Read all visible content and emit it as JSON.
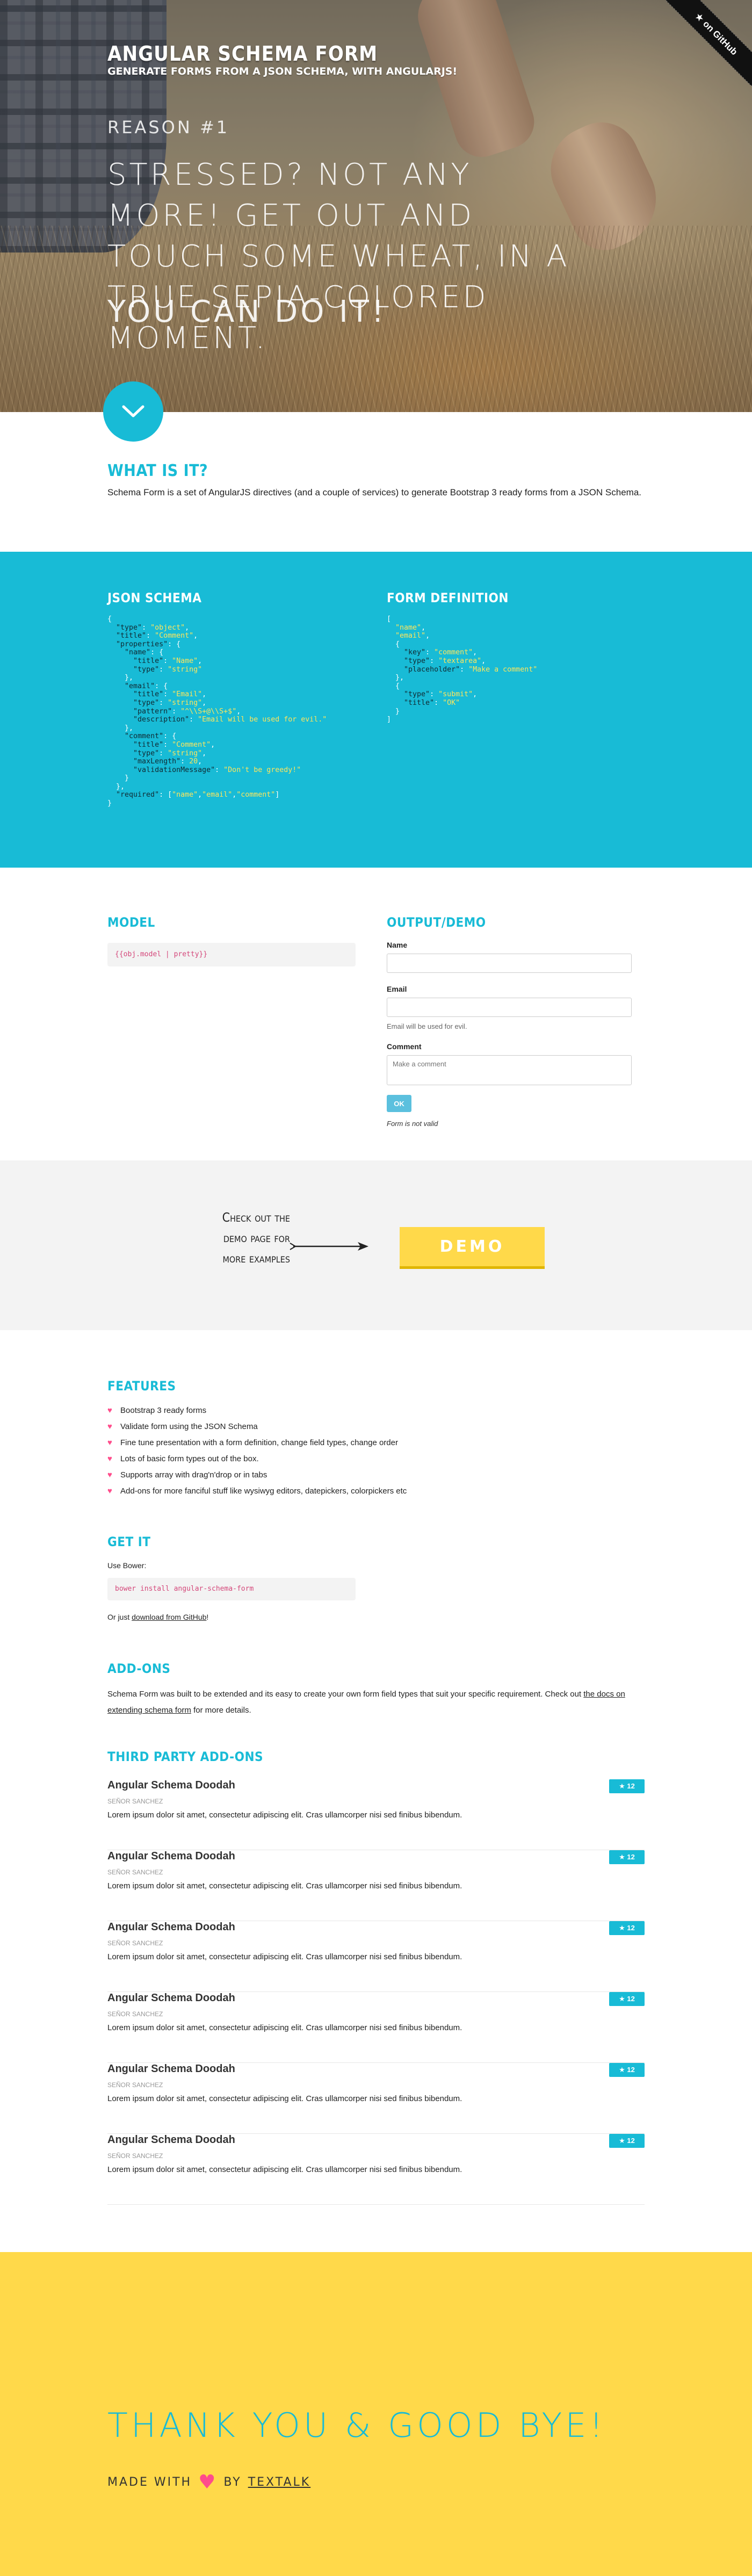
{
  "hero": {
    "title": "Angular Schema Form",
    "subtitle": "Generate forms from a JSON schema, with AngularJS!",
    "reason": "Reason #1",
    "quote": "Stressed? Not any more! Get out and touch some wheat, in a true sepia-colored moment.",
    "cta": "You can do it!",
    "github_ribbon": "on GitHub",
    "scroll_icon": "chevron-down-icon"
  },
  "what": {
    "heading": "What is it?",
    "text": "Schema Form is a set of AngularJS directives (and a couple of services) to generate Bootstrap 3 ready forms from a JSON Schema."
  },
  "schema": {
    "heading": "JSON Schema",
    "form_heading": "Form Definition"
  },
  "model": {
    "heading": "Model",
    "value": "{{obj.model | pretty}}"
  },
  "demo_form": {
    "heading": "Output/Demo",
    "name_label": "Name",
    "name_value": "",
    "email_label": "Email",
    "email_value": "",
    "email_help": "Email will be used for evil.",
    "comment_label": "Comment",
    "comment_placeholder": "Make a comment",
    "submit_label": "OK",
    "status": "Form is not valid"
  },
  "demo_cta": {
    "text": "Check out the demo page for more examples",
    "button": "Demo"
  },
  "features": {
    "heading": "Features",
    "items": [
      "Bootstrap 3 ready forms",
      "Validate form using the JSON Schema",
      "Fine tune presentation with a form definition, change field types, change order",
      "Lots of basic form types out of the box.",
      "Supports array with drag'n'drop or in tabs",
      "Add-ons for more fanciful stuff like wysiwyg editors, datepickers, colorpickers etc"
    ]
  },
  "get_it": {
    "heading": "Get it",
    "use_bower": "Use Bower:",
    "command": "bower install angular-schema-form",
    "or_prefix": "Or just ",
    "or_link": "download from GitHub",
    "or_suffix": "!"
  },
  "addons": {
    "heading": "Add-ons",
    "text_prefix": "Schema Form was built to be extended and its easy to create your own form field types that suit your specific requirement. Check out ",
    "link": "the docs on extending schema form",
    "text_suffix": " for more details."
  },
  "third_party": {
    "heading": "Third party add-ons",
    "items": [
      {
        "title": "Angular Schema Doodah",
        "author": "Señor Sanchez",
        "desc": "Lorem ipsum dolor sit amet, consectetur adipiscing elit. Cras ullamcorper nisi sed finibus bibendum.",
        "stars": "12"
      },
      {
        "title": "Angular Schema Doodah",
        "author": "Señor Sanchez",
        "desc": "Lorem ipsum dolor sit amet, consectetur adipiscing elit. Cras ullamcorper nisi sed finibus bibendum.",
        "stars": "12"
      },
      {
        "title": "Angular Schema Doodah",
        "author": "Señor Sanchez",
        "desc": "Lorem ipsum dolor sit amet, consectetur adipiscing elit. Cras ullamcorper nisi sed finibus bibendum.",
        "stars": "12"
      },
      {
        "title": "Angular Schema Doodah",
        "author": "Señor Sanchez",
        "desc": "Lorem ipsum dolor sit amet, consectetur adipiscing elit. Cras ullamcorper nisi sed finibus bibendum.",
        "stars": "12"
      },
      {
        "title": "Angular Schema Doodah",
        "author": "Señor Sanchez",
        "desc": "Lorem ipsum dolor sit amet, consectetur adipiscing elit. Cras ullamcorper nisi sed finibus bibendum.",
        "stars": "12"
      },
      {
        "title": "Angular Schema Doodah",
        "author": "Señor Sanchez",
        "desc": "Lorem ipsum dolor sit amet, consectetur adipiscing elit. Cras ullamcorper nisi sed finibus bibendum.",
        "stars": "12"
      }
    ]
  },
  "footer": {
    "title": "Thank you & good bye!",
    "made_with": "Made with",
    "by": "by",
    "company": "Textalk"
  },
  "colors": {
    "accent": "#18bbd6",
    "yellow": "#ffd94a",
    "pink": "#ff4c8b",
    "code_string": "#ffe65c"
  }
}
